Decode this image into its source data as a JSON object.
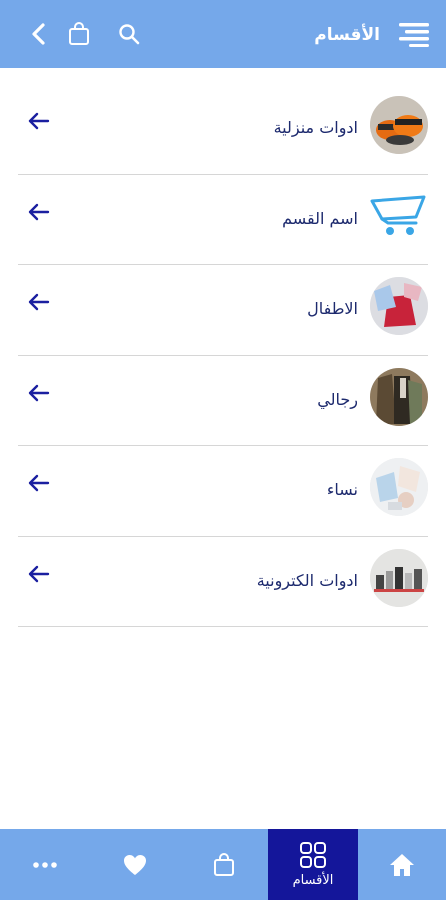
{
  "header": {
    "title": "الأقسام",
    "icons": [
      "back-arrow-icon",
      "shopping-bag-icon",
      "search-icon",
      "menu-icon"
    ]
  },
  "categories": [
    {
      "label": "ادوات منزلية"
    },
    {
      "label": "اسم القسم"
    },
    {
      "label": "الاطفال"
    },
    {
      "label": "رجالي"
    },
    {
      "label": "نساء"
    },
    {
      "label": "ادوات الكترونية"
    }
  ],
  "bottom_nav": {
    "active_label": "الأقسام",
    "items": [
      "home-icon",
      "grid-icon",
      "shopping-bag-icon",
      "heart-icon",
      "more-icon"
    ]
  },
  "colors": {
    "bar": "#75a8ea",
    "active_tab": "#14169a",
    "label": "#1d2a6e",
    "arrow": "#1a1fa0"
  }
}
